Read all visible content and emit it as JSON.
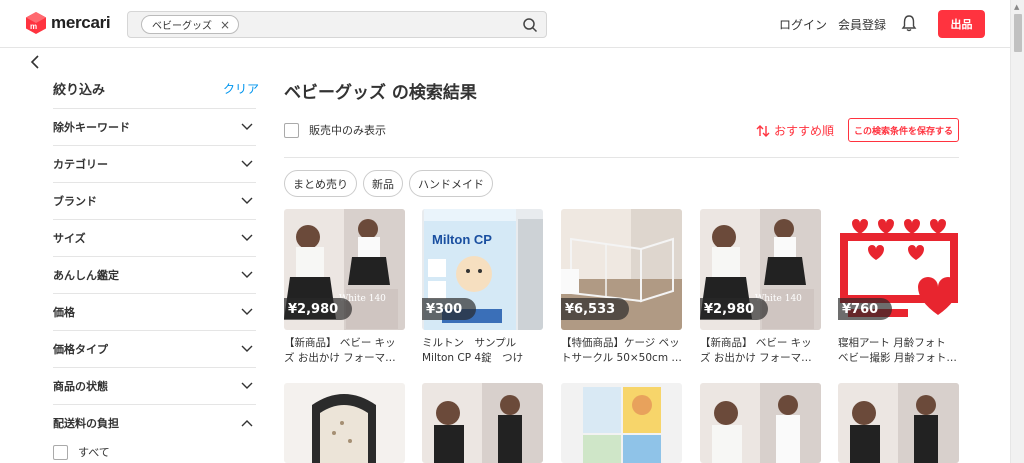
{
  "header": {
    "logo_text": "mercari",
    "search_chip": "ベビーグッズ",
    "login": "ログイン",
    "signup": "会員登録",
    "sell": "出品"
  },
  "sidebar": {
    "title": "絞り込み",
    "clear": "クリア",
    "filters": [
      "除外キーワード",
      "カテゴリー",
      "ブランド",
      "サイズ",
      "あんしん鑑定",
      "価格",
      "価格タイプ",
      "商品の状態",
      "配送料の負担"
    ],
    "all_label": "すべて"
  },
  "main": {
    "title": "ベビーグッズ の検索結果",
    "onsale_label": "販売中のみ表示",
    "sort_label": "おすすめ順",
    "save_label": "この検索条件を保存する",
    "tags": [
      "まとめ売り",
      "新品",
      "ハンドメイド"
    ],
    "items": [
      {
        "price": "¥2,980",
        "name": "【新商品】 ベビー キッズ お出かけ フォーマ…"
      },
      {
        "price": "¥300",
        "name": "ミルトン　サンプル　Milton CP 4錠　つけお…"
      },
      {
        "price": "¥6,533",
        "name": "【特価商品】ケージ ペットサークル 50×50cm …"
      },
      {
        "price": "¥2,980",
        "name": "【新商品】 ベビー キッズ お出かけ フォーマ…"
      },
      {
        "price": "¥760",
        "name": "寝相アート 月齢フォト ベビー撮影 月齢フォト…"
      }
    ],
    "thumb_texts": {
      "dress_label": "White 140",
      "milton_title": "Milton CP"
    }
  },
  "colors": {
    "accent": "#ff333f",
    "link": "#0095ee"
  }
}
